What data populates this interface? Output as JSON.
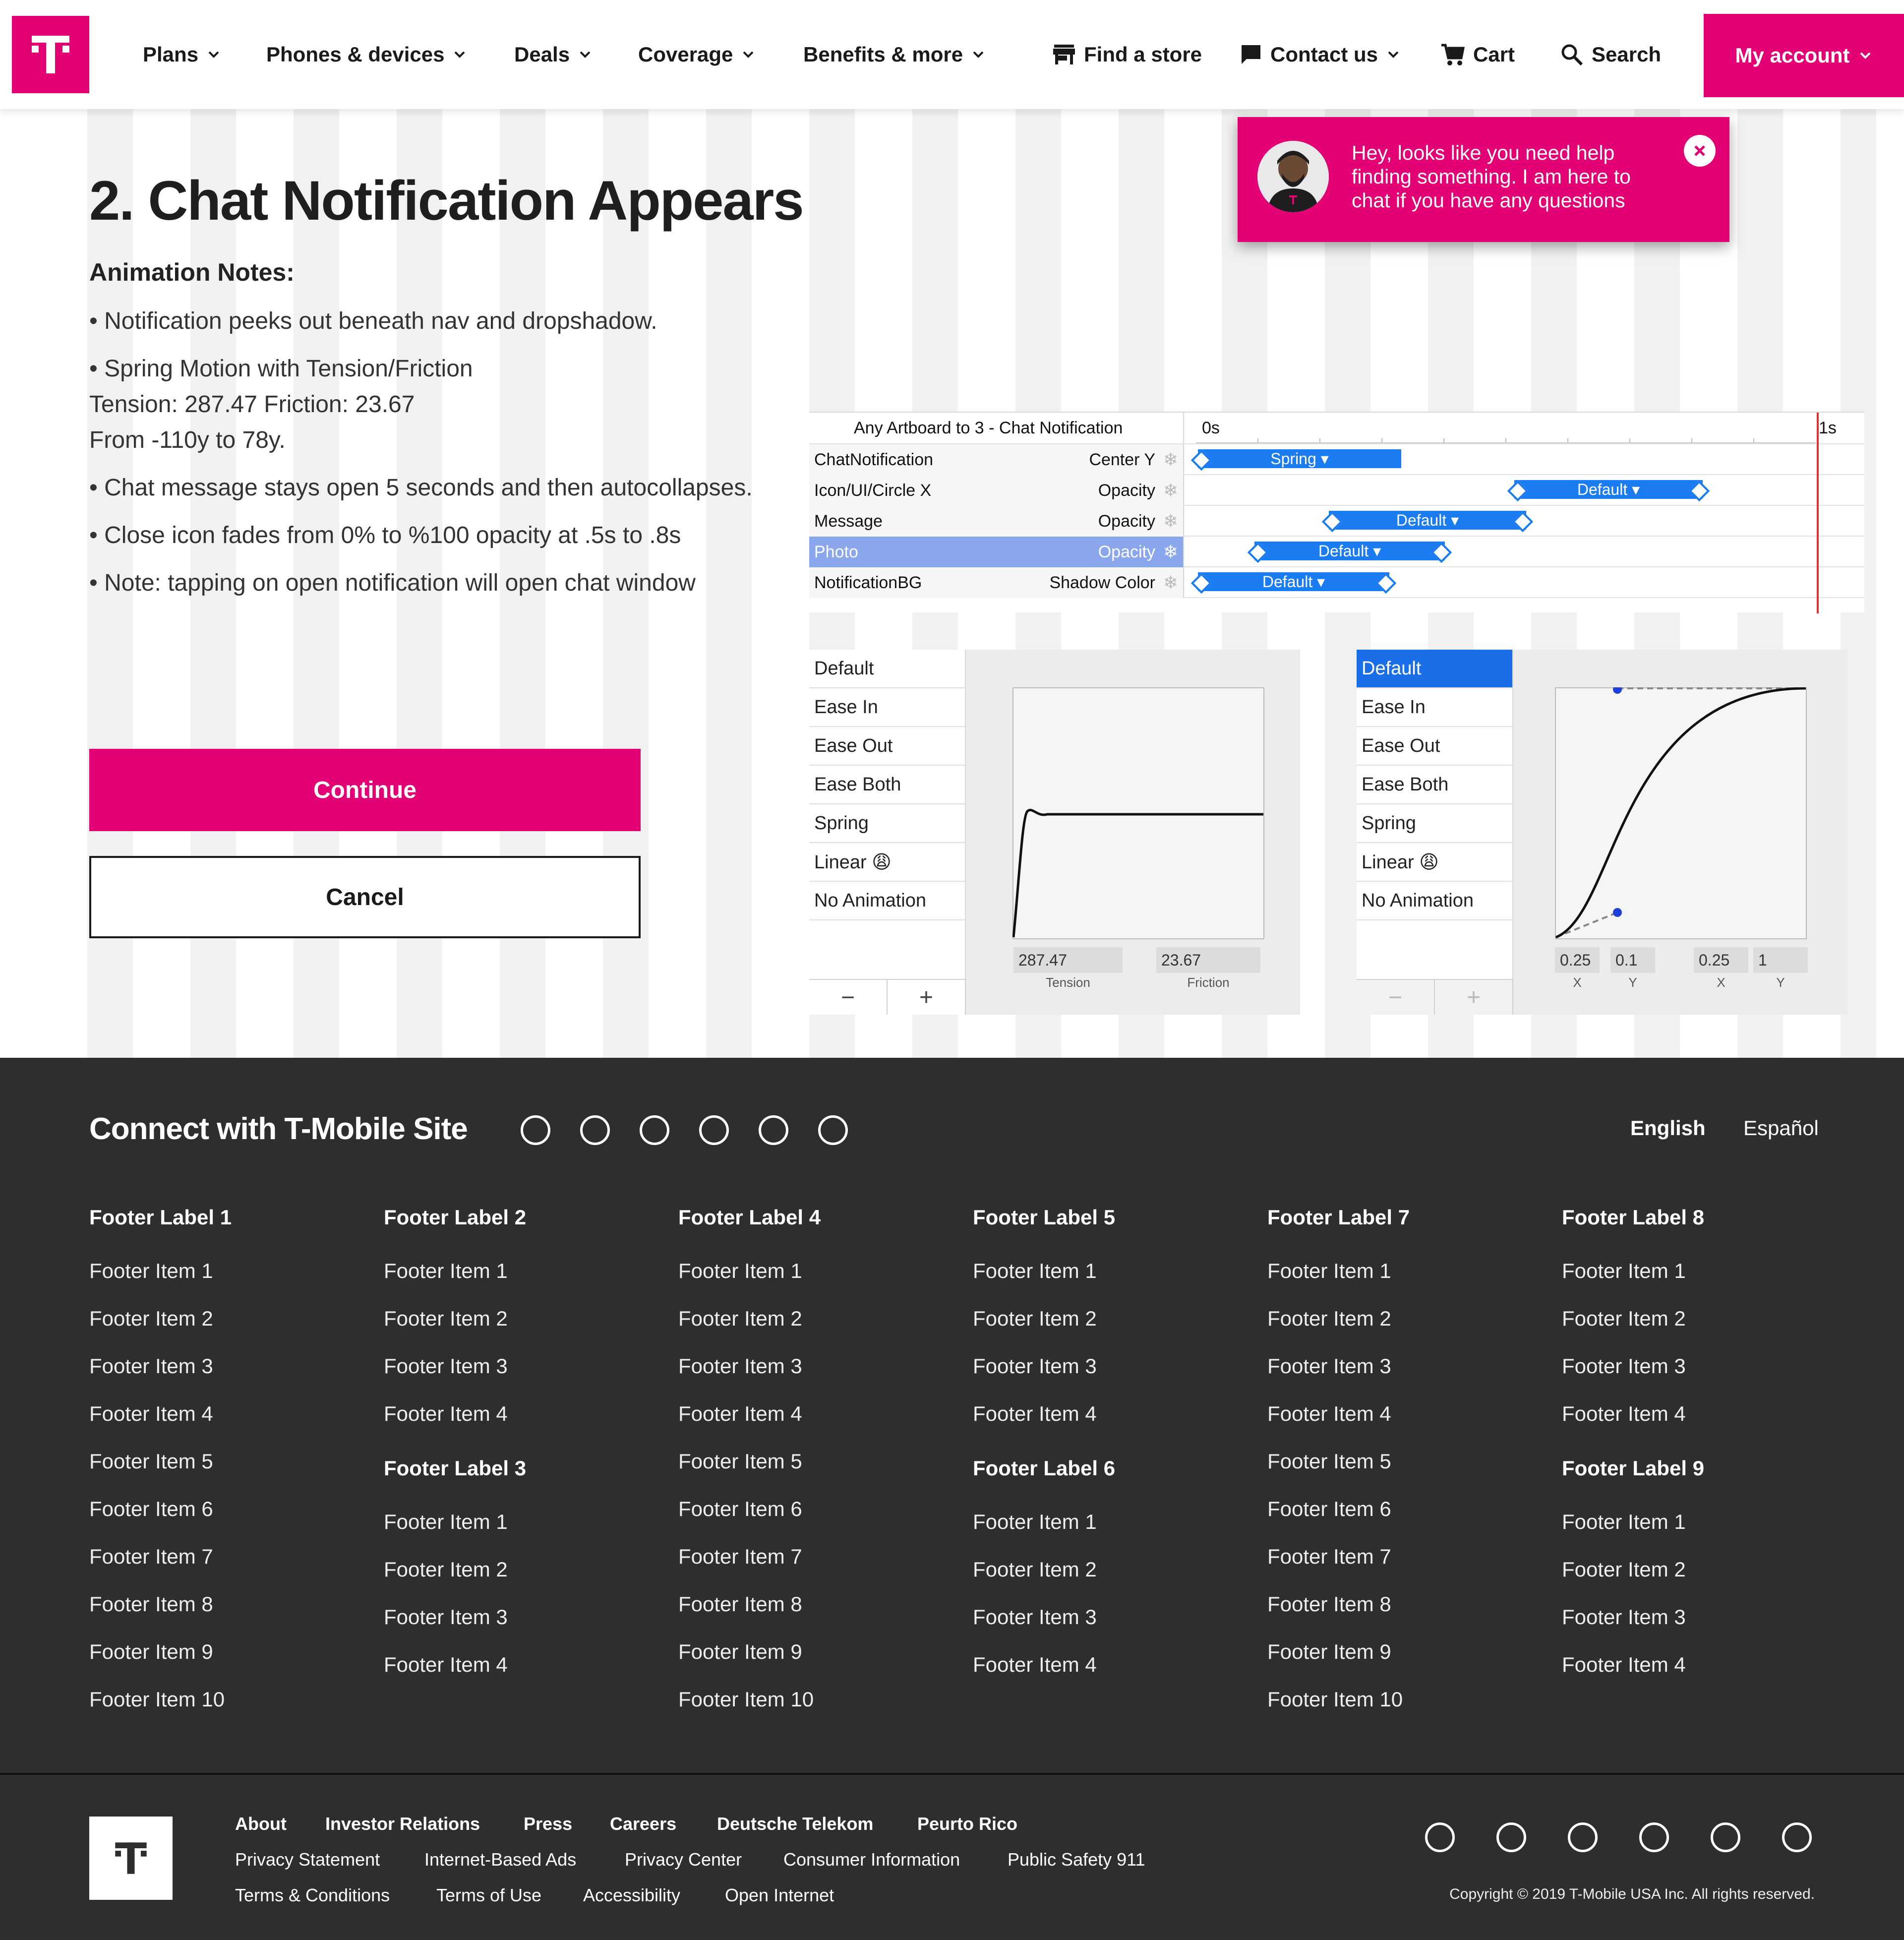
{
  "nav": {
    "items": [
      {
        "label": "Plans"
      },
      {
        "label": "Phones & devices"
      },
      {
        "label": "Deals"
      },
      {
        "label": "Coverage"
      },
      {
        "label": "Benefits & more"
      }
    ],
    "find_store": "Find a store",
    "contact": "Contact us",
    "cart": "Cart",
    "search": "Search",
    "account": "My account",
    "brand_color": "#e20074"
  },
  "main": {
    "title": "2. Chat Notification Appears",
    "notes_heading": "Animation Notes:",
    "notes": [
      "• Notification peeks out beneath nav and dropshadow.",
      "• Spring Motion with Tension/Friction",
      "Tension: 287.47   Friction: 23.67",
      "From -110y to 78y.",
      "• Chat message stays open 5 seconds and then autocollapses.",
      "• Close icon fades from 0% to %100 opacity at .5s to .8s",
      "• Note: tapping on open notification will open chat window"
    ],
    "continue": "Continue",
    "cancel": "Cancel"
  },
  "chat": {
    "message": "Hey, looks like you need help finding something. I am here to chat if you have any questions"
  },
  "timeline": {
    "header": "Any Artboard to 3 - Chat Notification",
    "t0": "0s",
    "t1": "1s",
    "rows": [
      {
        "name": "ChatNotification",
        "prop": "Center Y",
        "bar": "Spring ▾"
      },
      {
        "name": "Icon/UI/Circle X",
        "prop": "Opacity",
        "bar": "Default ▾"
      },
      {
        "name": "Message",
        "prop": "Opacity",
        "bar": "Default ▾"
      },
      {
        "name": "Photo",
        "prop": "Opacity",
        "bar": "Default ▾"
      },
      {
        "name": "NotificationBG",
        "prop": "Shadow Color",
        "bar": "Default ▾"
      }
    ]
  },
  "easing": {
    "options": [
      "Default",
      "Ease In",
      "Ease Out",
      "Ease Both",
      "Spring",
      "Linear 😩",
      "No Animation"
    ],
    "spring": {
      "tension": "287.47",
      "friction": "23.67",
      "tension_label": "Tension",
      "friction_label": "Friction"
    },
    "bezier": {
      "v1": "0.25",
      "v2": "0.1",
      "v3": "0.25",
      "v4": "1",
      "l1": "X",
      "l2": "Y",
      "l3": "X",
      "l4": "Y"
    },
    "minus": "−",
    "plus": "+"
  },
  "footer": {
    "connect": "Connect with T-Mobile Site",
    "lang_en": "English",
    "lang_es": "Español",
    "col1": {
      "label": "Footer Label 1",
      "items": [
        "Footer Item 1",
        "Footer Item 2",
        "Footer Item 3",
        "Footer Item 4",
        "Footer Item 5",
        "Footer Item 6",
        "Footer Item 7",
        "Footer Item 8",
        "Footer Item 9",
        "Footer Item 10"
      ]
    },
    "col2": {
      "label": "Footer Label 2",
      "items": [
        "Footer Item 1",
        "Footer Item 2",
        "Footer Item 3",
        "Footer Item 4"
      ],
      "label_b": "Footer Label 3",
      "items_b": [
        "Footer Item 1",
        "Footer Item 2",
        "Footer Item 3",
        "Footer Item 4"
      ]
    },
    "col3": {
      "label": "Footer Label 4",
      "items": [
        "Footer Item 1",
        "Footer Item 2",
        "Footer Item 3",
        "Footer Item 4",
        "Footer Item 5",
        "Footer Item 6",
        "Footer Item 7",
        "Footer Item 8",
        "Footer Item 9",
        "Footer Item 10"
      ]
    },
    "col4": {
      "label": "Footer Label 5",
      "items": [
        "Footer Item 1",
        "Footer Item 2",
        "Footer Item 3",
        "Footer Item 4"
      ],
      "label_b": "Footer Label 6",
      "items_b": [
        "Footer Item 1",
        "Footer Item 2",
        "Footer Item 3",
        "Footer Item 4"
      ]
    },
    "col5": {
      "label": "Footer Label 7",
      "items": [
        "Footer Item 1",
        "Footer Item 2",
        "Footer Item 3",
        "Footer Item 4",
        "Footer Item 5",
        "Footer Item 6",
        "Footer Item 7",
        "Footer Item 8",
        "Footer Item 9",
        "Footer Item 10"
      ]
    },
    "col6": {
      "label": "Footer Label 8",
      "items": [
        "Footer Item 1",
        "Footer Item 2",
        "Footer Item 3",
        "Footer Item 4"
      ],
      "label_b": "Footer Label 9",
      "items_b": [
        "Footer Item 1",
        "Footer Item 2",
        "Footer Item 3",
        "Footer Item 4"
      ]
    }
  },
  "legal": {
    "row1": [
      "About",
      "Investor Relations",
      "Press",
      "Careers",
      "Deutsche Telekom",
      "Peurto Rico"
    ],
    "row2": [
      "Privacy Statement",
      "Internet-Based Ads",
      "Privacy Center",
      "Consumer Information",
      "Public Safety 911"
    ],
    "row3": [
      "Terms & Conditions",
      "Terms of Use",
      "Accessibility",
      "Open Internet"
    ],
    "copyright": "Copyright © 2019 T-Mobile USA Inc. All rights reserved."
  }
}
